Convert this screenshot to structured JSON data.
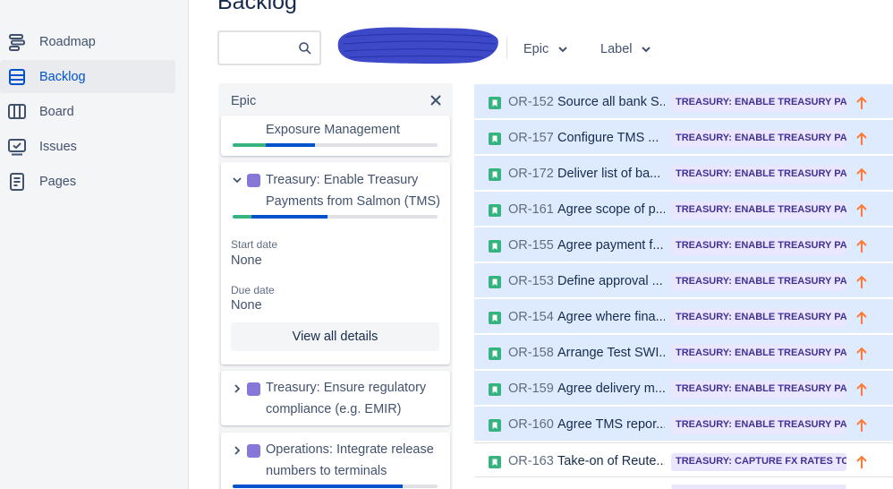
{
  "sidebar": {
    "items": [
      {
        "label": "Roadmap",
        "icon": "roadmap-icon",
        "active": false
      },
      {
        "label": "Backlog",
        "icon": "backlog-icon",
        "active": true
      },
      {
        "label": "Board",
        "icon": "board-icon",
        "active": false
      },
      {
        "label": "Issues",
        "icon": "issues-icon",
        "active": false
      },
      {
        "label": "Pages",
        "icon": "pages-icon",
        "active": false
      }
    ]
  },
  "header": {
    "title": "Backlog",
    "search": {
      "value": "",
      "placeholder": ""
    },
    "filters": [
      {
        "label": "Epic"
      },
      {
        "label": "Label"
      }
    ]
  },
  "epic_panel": {
    "title": "Epic",
    "epics": [
      {
        "name": "Exposure Management",
        "progress_done": 0.16,
        "progress_in_progress": 0.24
      },
      {
        "name": "Treasury: Enable Treasury Payments from Salmon (TMS)",
        "expanded": true,
        "progress_done": 0.09,
        "progress_in_progress": 0.37,
        "start_date_label": "Start date",
        "start_date": "None",
        "due_date_label": "Due date",
        "due_date": "None",
        "view_all": "View all details"
      },
      {
        "name": "Treasury: Ensure regulatory compliance (e.g. EMIR)",
        "expanded": false
      },
      {
        "name": "Operations: Integrate release numbers to terminals",
        "expanded": false,
        "progress_done": 0.0,
        "progress_in_progress": 0.83
      }
    ]
  },
  "issues": [
    {
      "key": "OR-152",
      "summary": "Source all bank S...",
      "epic": "TREASURY: ENABLE TREASURY PA...",
      "selected": true
    },
    {
      "key": "OR-157",
      "summary": "Configure TMS ...",
      "epic": "TREASURY: ENABLE TREASURY PA...",
      "selected": true
    },
    {
      "key": "OR-172",
      "summary": "Deliver list of ba...",
      "epic": "TREASURY: ENABLE TREASURY PA...",
      "selected": true
    },
    {
      "key": "OR-161",
      "summary": "Agree scope of p...",
      "epic": "TREASURY: ENABLE TREASURY PA...",
      "selected": true
    },
    {
      "key": "OR-155",
      "summary": "Agree payment f...",
      "epic": "TREASURY: ENABLE TREASURY PA...",
      "selected": true
    },
    {
      "key": "OR-153",
      "summary": "Define approval ...",
      "epic": "TREASURY: ENABLE TREASURY PA...",
      "selected": true
    },
    {
      "key": "OR-154",
      "summary": "Agree where fina...",
      "epic": "TREASURY: ENABLE TREASURY PA...",
      "selected": true
    },
    {
      "key": "OR-158",
      "summary": "Arrange Test SWI...",
      "epic": "TREASURY: ENABLE TREASURY PA...",
      "selected": true
    },
    {
      "key": "OR-159",
      "summary": "Agree delivery m...",
      "epic": "TREASURY: ENABLE TREASURY PA...",
      "selected": true
    },
    {
      "key": "OR-160",
      "summary": "Agree TMS repor...",
      "epic": "TREASURY: ENABLE TREASURY PA...",
      "selected": true
    },
    {
      "key": "OR-163",
      "summary": "Take-on of Reute...",
      "epic": "TREASURY: CAPTURE FX RATES TO...",
      "selected": false
    }
  ],
  "colors": {
    "accent": "#0052cc",
    "selected_row": "#deebff",
    "epic_purple": "#8777d9",
    "lozenge_bg": "#eae6ff",
    "lozenge_text": "#403294",
    "story_green": "#36b37e",
    "priority_orange": "#ff7a33",
    "redaction_blue": "#3d49c8"
  }
}
